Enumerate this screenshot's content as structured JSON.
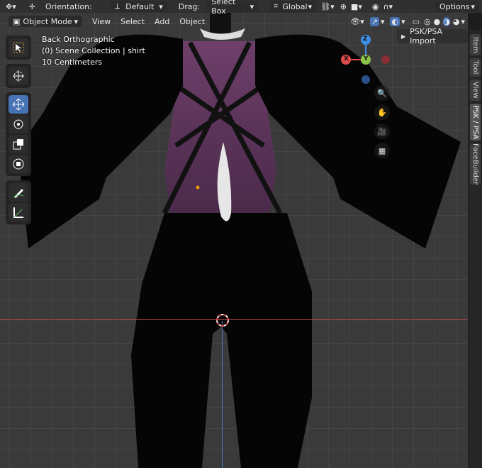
{
  "header": {
    "orientation_label": "Orientation:",
    "orientation_value": "Default",
    "drag_label": "Drag:",
    "drag_value": "Select Box",
    "transform_space": "Global",
    "options_label": "Options"
  },
  "viewport_header": {
    "mode": "Object Mode",
    "menus": [
      "View",
      "Select",
      "Add",
      "Object"
    ]
  },
  "overlay": {
    "view_name": "Back Orthographic",
    "collection": "(0) Scene Collection | shirt",
    "scale": "10 Centimeters"
  },
  "tools": [
    "select-box",
    "cursor",
    "move",
    "rotate",
    "scale",
    "transform",
    "annotate",
    "measure"
  ],
  "active_tool": "move",
  "gizmo": {
    "z_label": "Z",
    "y_label": "Y",
    "x_label": "X"
  },
  "sidebar_panel": {
    "title": "PSK/PSA Import"
  },
  "side_tabs": [
    "Item",
    "Tool",
    "View",
    "PSK / PSA",
    "FaceBuilder"
  ],
  "active_tab": "PSK / PSA",
  "colors": {
    "accent": "#4772b3",
    "x_axis": "#e04c4c",
    "y_axis": "#8bc34a",
    "z_axis": "#3f8fe8"
  }
}
